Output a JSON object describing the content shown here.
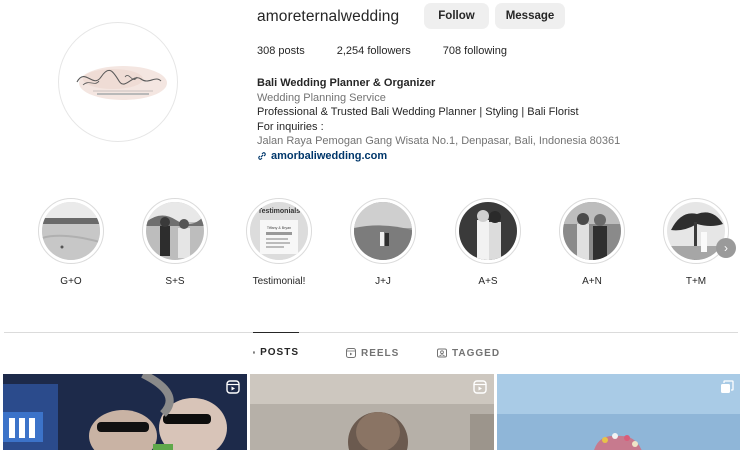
{
  "profile": {
    "username": "amoreternalwedding",
    "follow_label": "Follow",
    "message_label": "Message",
    "stats": [
      {
        "value": "308",
        "label": "posts"
      },
      {
        "value": "2,254",
        "label": "followers"
      },
      {
        "value": "708",
        "label": "following"
      }
    ],
    "bio": {
      "name": "Bali Wedding Planner & Organizer",
      "category": "Wedding Planning Service",
      "line1": "Professional & Trusted Bali Wedding Planner | Styling | Bali Florist",
      "line2": "For inquiries :",
      "address": "Jalan Raya Pemogan Gang Wisata No.1, Denpasar, Bali, Indonesia 80361",
      "link": "amorbaliwedding.com"
    },
    "avatar_text": {
      "script": "Amor Eternal",
      "sub": "BALI WEDDING & EVENTS"
    }
  },
  "highlights": [
    {
      "label": "G+O",
      "icon": "beach-photo"
    },
    {
      "label": "S+S",
      "icon": "couple-photo"
    },
    {
      "label": "Testimonial!",
      "icon": "testimonial-card",
      "card_title": "Testimonials",
      "card_line": "Tiffany & Bryan"
    },
    {
      "label": "J+J",
      "icon": "field-photo"
    },
    {
      "label": "A+S",
      "icon": "couple-photo"
    },
    {
      "label": "A+N",
      "icon": "couple-photo"
    },
    {
      "label": "T+M",
      "icon": "tree-photo"
    }
  ],
  "tabs": [
    {
      "label": "POSTS",
      "icon": "grid-icon",
      "active": true
    },
    {
      "label": "REELS",
      "icon": "reels-icon",
      "active": false
    },
    {
      "label": "TAGGED",
      "icon": "tagged-icon",
      "active": false
    }
  ],
  "posts": [
    {
      "type": "reel",
      "badge": "reels-icon"
    },
    {
      "type": "reel",
      "badge": "reels-icon"
    },
    {
      "type": "carousel",
      "badge": "carousel-icon"
    }
  ],
  "colors": {
    "link": "#00376b",
    "button_bg": "#efefef",
    "muted_text": "#737373",
    "divider": "#dbdbdb"
  }
}
